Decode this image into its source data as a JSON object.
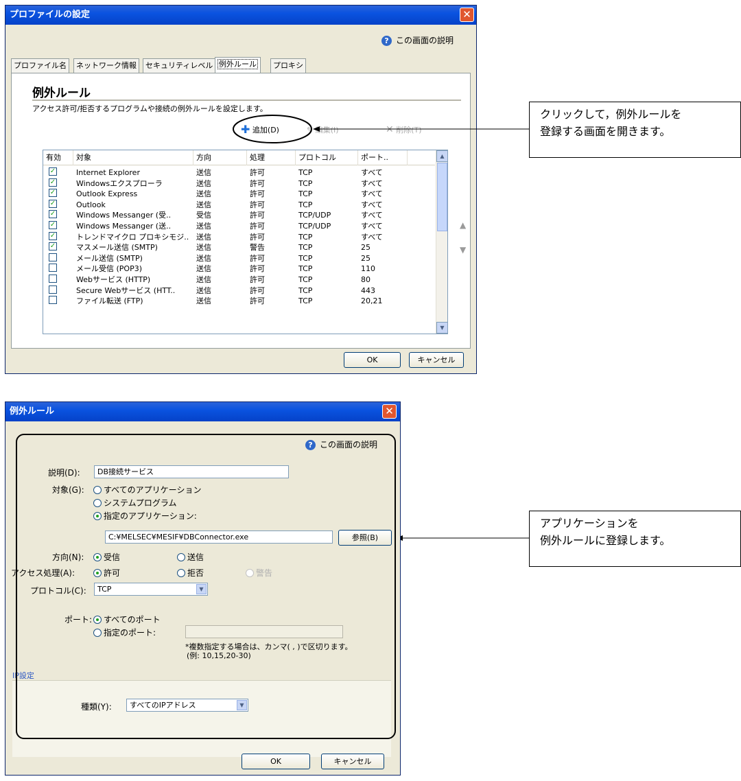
{
  "dialog1": {
    "title": "プロファイルの設定",
    "close": "✕",
    "help": "この画面の説明",
    "tabs": [
      "プロファイル名",
      "ネットワーク情報",
      "セキュリティレベル",
      "例外ルール",
      "プロキシ"
    ],
    "section_title": "例外ルール",
    "description": "アクセス許可/拒否するプログラムや接続の例外ルールを設定します。",
    "add_button": "追加(D)",
    "edit_button": "編集(I)",
    "delete_button": "削除(T)",
    "columns": [
      "有効",
      "対象",
      "方向",
      "処理",
      "プロトコル",
      "ポート.."
    ],
    "rows": [
      {
        "enabled": true,
        "target": "Internet Explorer",
        "direction": "送信",
        "action": "許可",
        "protocol": "TCP",
        "port": "すべて"
      },
      {
        "enabled": true,
        "target": "Windowsエクスプローラ",
        "direction": "送信",
        "action": "許可",
        "protocol": "TCP",
        "port": "すべて"
      },
      {
        "enabled": true,
        "target": "Outlook Express",
        "direction": "送信",
        "action": "許可",
        "protocol": "TCP",
        "port": "すべて"
      },
      {
        "enabled": true,
        "target": "Outlook",
        "direction": "送信",
        "action": "許可",
        "protocol": "TCP",
        "port": "すべて"
      },
      {
        "enabled": true,
        "target": "Windows Messanger (受..",
        "direction": "受信",
        "action": "許可",
        "protocol": "TCP/UDP",
        "port": "すべて"
      },
      {
        "enabled": true,
        "target": "Windows Messanger (送..",
        "direction": "送信",
        "action": "許可",
        "protocol": "TCP/UDP",
        "port": "すべて"
      },
      {
        "enabled": true,
        "target": "トレンドマイクロ プロキシモジ..",
        "direction": "送信",
        "action": "許可",
        "protocol": "TCP",
        "port": "すべて"
      },
      {
        "enabled": true,
        "target": "マスメール送信 (SMTP)",
        "direction": "送信",
        "action": "警告",
        "protocol": "TCP",
        "port": "25"
      },
      {
        "enabled": false,
        "target": "メール送信 (SMTP)",
        "direction": "送信",
        "action": "許可",
        "protocol": "TCP",
        "port": "25"
      },
      {
        "enabled": false,
        "target": "メール受信 (POP3)",
        "direction": "送信",
        "action": "許可",
        "protocol": "TCP",
        "port": "110"
      },
      {
        "enabled": false,
        "target": "Webサービス (HTTP)",
        "direction": "送信",
        "action": "許可",
        "protocol": "TCP",
        "port": "80"
      },
      {
        "enabled": false,
        "target": "Secure Webサービス (HTT..",
        "direction": "送信",
        "action": "許可",
        "protocol": "TCP",
        "port": "443"
      },
      {
        "enabled": false,
        "target": "ファイル転送 (FTP)",
        "direction": "送信",
        "action": "許可",
        "protocol": "TCP",
        "port": "20,21"
      }
    ],
    "ok_button": "OK",
    "cancel_button": "キャンセル"
  },
  "callout1": {
    "line1": "クリックして，例外ルールを",
    "line2": "登録する画面を開きます。"
  },
  "dialog2": {
    "title": "例外ルール",
    "close": "✕",
    "help": "この画面の説明",
    "description_label": "説明(D):",
    "description_value": "DB接続サービス",
    "target_label": "対象(G):",
    "target_options": [
      "すべてのアプリケーション",
      "システムプログラム",
      "指定のアプリケーション:"
    ],
    "path_value": "C:¥MELSEC¥MESIF¥DBConnector.exe",
    "browse_button": "参照(B)",
    "direction_label": "方向(N):",
    "direction_receive": "受信",
    "direction_send": "送信",
    "access_label": "アクセス処理(A):",
    "access_allow": "許可",
    "access_deny": "拒否",
    "access_warn": "警告",
    "protocol_label": "プロトコル(C):",
    "protocol_value": "TCP",
    "port_label": "ポート:",
    "port_all": "すべてのポート",
    "port_specific": "指定のポート:",
    "port_note1": "*複数指定する場合は、カンマ( , )で区切ります。",
    "port_note2": "(例: 10,15,20-30)",
    "ip_section": "IP設定",
    "ip_type_label": "種類(Y):",
    "ip_type_value": "すべてのIPアドレス",
    "ok_button": "OK",
    "cancel_button": "キャンセル"
  },
  "callout2": {
    "line1": "アプリケーションを",
    "line2": "例外ルールに登録します。"
  }
}
